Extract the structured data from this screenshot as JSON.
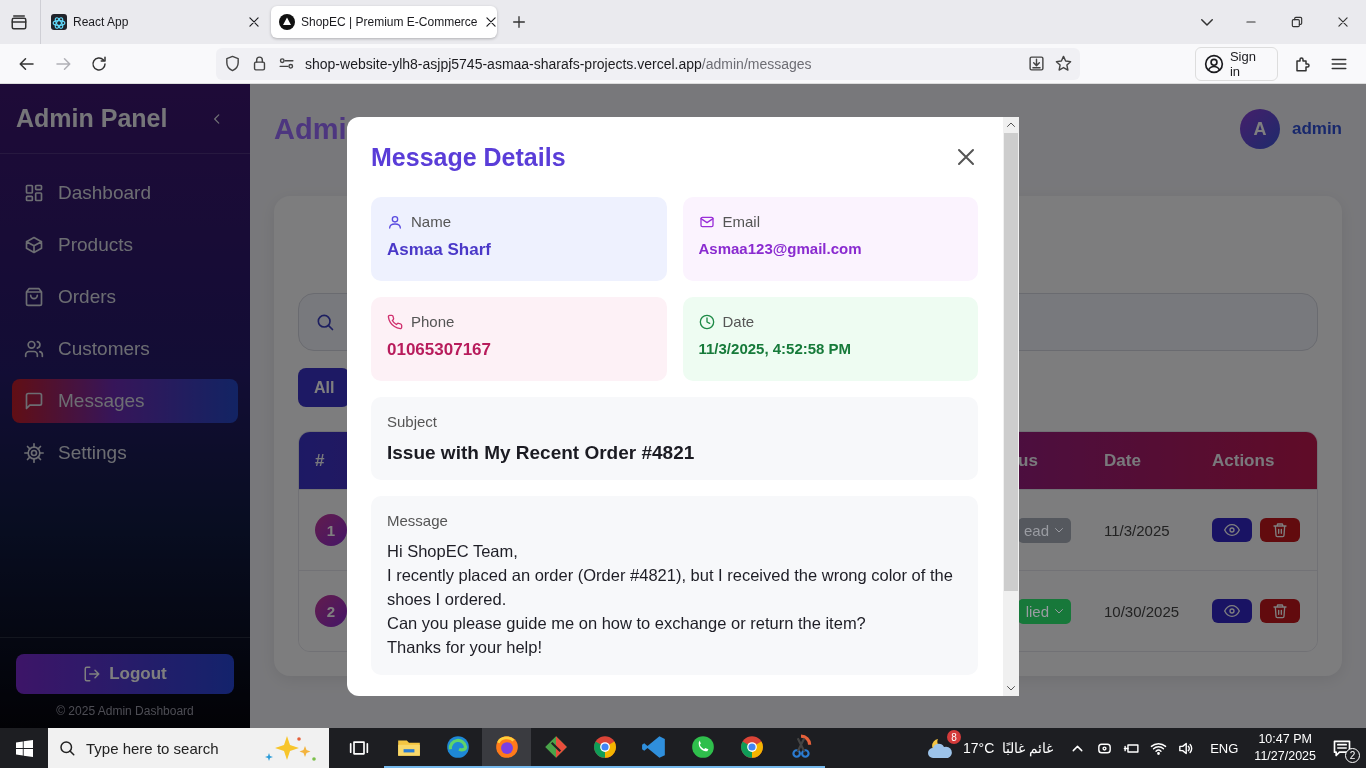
{
  "browser": {
    "tabs": [
      {
        "title": "React App",
        "selected": false
      },
      {
        "title": "ShopEC | Premium E-Commerce",
        "selected": true
      }
    ],
    "forward_disabled": true,
    "url": {
      "host": "shop-website-ylh8-asjpj5745-asmaa-sharafs-projects.vercel.app",
      "path": "/admin/messages"
    },
    "sign_in": "Sign in"
  },
  "sidebar": {
    "title": "Admin Panel",
    "items": [
      {
        "label": "Dashboard",
        "selected": false
      },
      {
        "label": "Products",
        "selected": false
      },
      {
        "label": "Orders",
        "selected": false
      },
      {
        "label": "Customers",
        "selected": false
      },
      {
        "label": "Messages",
        "selected": true
      },
      {
        "label": "Settings",
        "selected": false
      }
    ],
    "logout": "Logout",
    "footer": "© 2025 Admin Dashboard"
  },
  "header": {
    "title": "Admi",
    "user": {
      "initial": "A",
      "name": "admin"
    }
  },
  "filters": [
    {
      "label": "All",
      "selected": true
    }
  ],
  "table": {
    "columns": [
      "#",
      "us",
      "Date",
      "Actions"
    ],
    "rows": [
      {
        "number": "1",
        "status": "ead",
        "color": "#55585e",
        "date": "11/3/2025"
      },
      {
        "number": "2",
        "status": "lied",
        "color": "#17783a",
        "date": "10/30/2025"
      }
    ]
  },
  "modal": {
    "title": "Message Details",
    "fields": [
      {
        "kind": "name",
        "label": "Name",
        "value": "Asmaa Sharf"
      },
      {
        "kind": "email",
        "label": "Email",
        "value": "Asmaa123@gmail.com"
      },
      {
        "kind": "phone",
        "label": "Phone",
        "value": "01065307167"
      },
      {
        "kind": "date",
        "label": "Date",
        "value": "11/3/2025, 4:52:58 PM"
      }
    ],
    "subject": {
      "label": "Subject",
      "value": "Issue with My Recent Order #4821"
    },
    "message": {
      "label": "Message",
      "lines": [
        "Hi ShopEC Team,",
        "I recently placed an order (Order #4821), but I received the wrong color of the shoes I ordered.",
        "Can you please guide me on how to exchange or return the item?",
        "Thanks for your help!"
      ]
    }
  },
  "taskbar": {
    "search_placeholder": "Type here to search",
    "apps": [
      {
        "kind": "folder",
        "active": false
      },
      {
        "kind": "edge",
        "active": false
      },
      {
        "kind": "firefox",
        "active": true
      },
      {
        "kind": "git",
        "active": false
      },
      {
        "kind": "chrome",
        "active": false
      },
      {
        "kind": "code",
        "active": false
      },
      {
        "kind": "whatsapp",
        "active": false
      },
      {
        "kind": "chrome",
        "active": false
      },
      {
        "kind": "snip",
        "active": false
      }
    ],
    "weather": {
      "badge": "8",
      "temperature": "17°C",
      "condition": "غائم غالبًا"
    },
    "language": "ENG",
    "time": "10:47 PM",
    "date": "11/27/2025",
    "notifications": "2"
  }
}
